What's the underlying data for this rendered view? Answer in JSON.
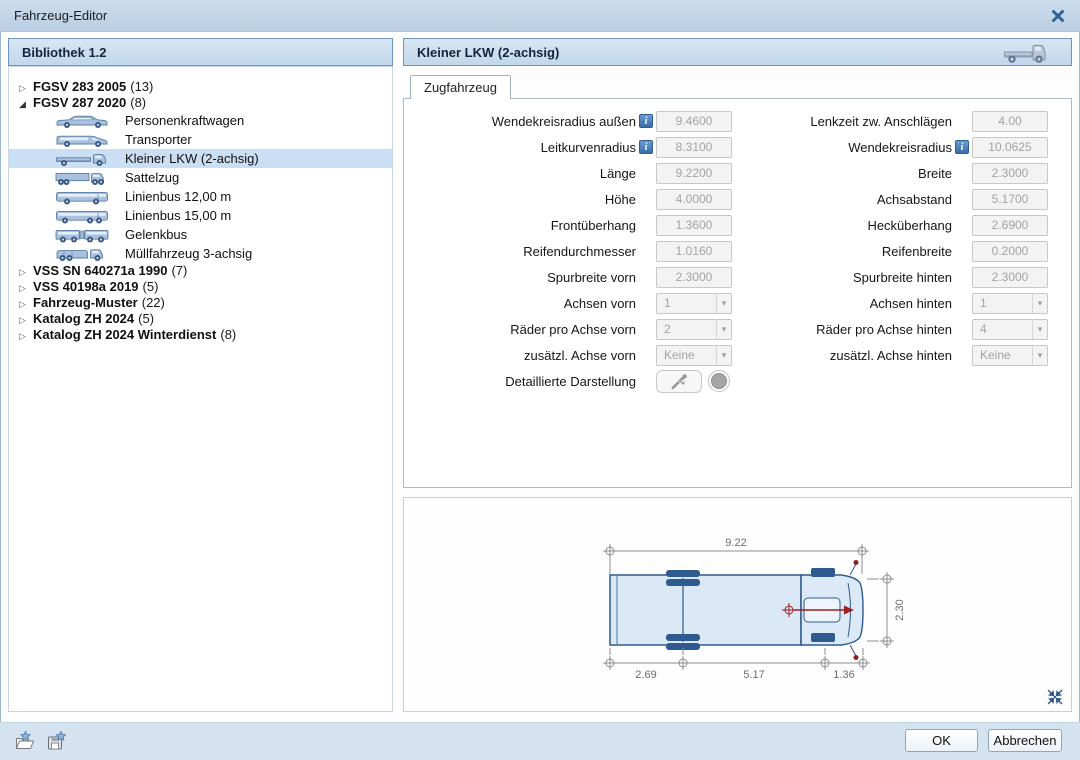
{
  "window": {
    "title": "Fahrzeug-Editor"
  },
  "library": {
    "header": "Bibliothek 1.2"
  },
  "detail": {
    "header": "Kleiner LKW (2-achsig)",
    "tab": "Zugfahrzeug"
  },
  "tree": {
    "items": [
      {
        "label": "FGSV 283 2005",
        "count": "(13)",
        "expanded": false
      },
      {
        "label": "FGSV 287 2020",
        "count": "(8)",
        "expanded": true,
        "children": [
          {
            "label": "Personenkraftwagen",
            "icon": "car"
          },
          {
            "label": "Transporter",
            "icon": "van"
          },
          {
            "label": "Kleiner LKW (2-achsig)",
            "icon": "small-truck",
            "selected": true
          },
          {
            "label": "Sattelzug",
            "icon": "semi-truck"
          },
          {
            "label": "Linienbus 12,00 m",
            "icon": "bus"
          },
          {
            "label": "Linienbus 15,00 m",
            "icon": "long-bus"
          },
          {
            "label": "Gelenkbus",
            "icon": "articulated-bus"
          },
          {
            "label": "Müllfahrzeug 3-achsig",
            "icon": "garbage-truck"
          }
        ]
      },
      {
        "label": "VSS SN 640271a 1990",
        "count": "(7)",
        "expanded": false
      },
      {
        "label": "VSS 40198a 2019",
        "count": "(5)",
        "expanded": false
      },
      {
        "label": "Fahrzeug-Muster",
        "count": "(22)",
        "expanded": false
      },
      {
        "label": "Katalog ZH 2024",
        "count": "(5)",
        "expanded": false
      },
      {
        "label": "Katalog ZH 2024 Winterdienst",
        "count": "(8)",
        "expanded": false
      }
    ]
  },
  "form": {
    "left": [
      {
        "label": "Wendekreisradius außen",
        "value": "9.4600",
        "info": true
      },
      {
        "label": "Leitkurvenradius",
        "value": "8.3100",
        "info": true
      },
      {
        "label": "Länge",
        "value": "9.2200"
      },
      {
        "label": "Höhe",
        "value": "4.0000"
      },
      {
        "label": "Frontüberhang",
        "value": "1.3600"
      },
      {
        "label": "Reifendurchmesser",
        "value": "1.0160"
      },
      {
        "label": "Spurbreite vorn",
        "value": "2.3000"
      },
      {
        "label": "Achsen vorn",
        "value": "1",
        "dropdown": true
      },
      {
        "label": "Räder pro Achse vorn",
        "value": "2",
        "dropdown": true
      },
      {
        "label": "zusätzl. Achse vorn",
        "value": "Keine",
        "dropdown": true
      }
    ],
    "right": [
      {
        "label": "Lenkzeit zw. Anschlägen",
        "value": "4.00"
      },
      {
        "label": "Wendekreisradius",
        "value": "10.0625",
        "info": true
      },
      {
        "label": "Breite",
        "value": "2.3000"
      },
      {
        "label": "Achsabstand",
        "value": "5.1700"
      },
      {
        "label": "Hecküberhang",
        "value": "2.6900"
      },
      {
        "label": "Reifenbreite",
        "value": "0.2000"
      },
      {
        "label": "Spurbreite hinten",
        "value": "2.3000"
      },
      {
        "label": "Achsen hinten",
        "value": "1",
        "dropdown": true
      },
      {
        "label": "Räder pro Achse hinten",
        "value": "4",
        "dropdown": true
      },
      {
        "label": "zusätzl. Achse hinten",
        "value": "Keine",
        "dropdown": true
      }
    ],
    "detail_label": "Detaillierte Darstellung"
  },
  "drawing": {
    "length_total": "9.22",
    "width": "2.30",
    "rear_overhang": "2.69",
    "wheelbase": "5.17",
    "front_overhang": "1.36"
  },
  "footer": {
    "ok": "OK",
    "cancel": "Abbrechen"
  },
  "icons": {
    "close": "x-cross",
    "expand_arrow": "▷",
    "collapse_arrow": "◢",
    "dropdown_arrow": "▾",
    "info": "i"
  },
  "colors": {
    "header_bg": "#c9dcee",
    "header_border": "#6e96bd",
    "selection": "#cbdff4",
    "accent_blue": "#2e5a8f",
    "disabled_text": "#a3a3a3",
    "dim_gray": "#8d8d8d",
    "dim_red": "#a11f1f",
    "titlebar_bg": "#c3d5e7",
    "footer_bg": "#d5e2ef"
  }
}
